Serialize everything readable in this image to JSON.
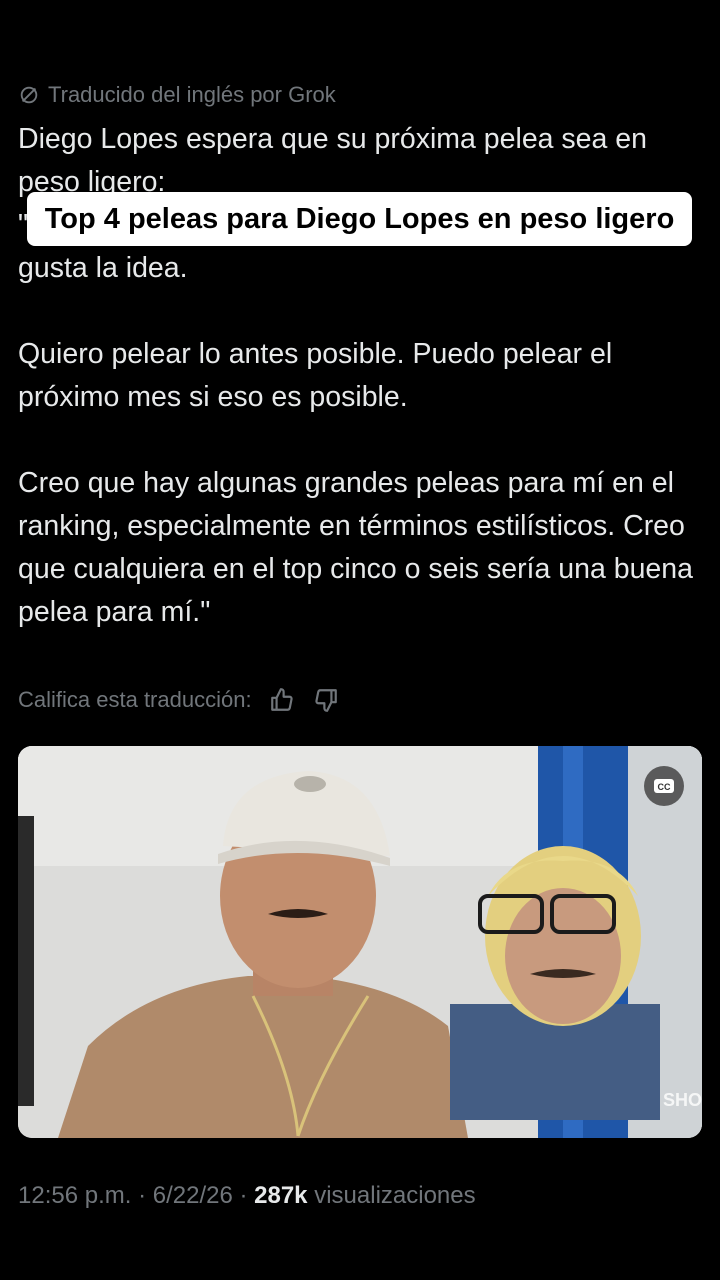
{
  "translation_note": "Traducido del inglés por Grok",
  "overlay_title": "Top 4 peleas para Diego Lopes en peso ligero",
  "tweet": {
    "line1": "Diego Lopes espera que su próxima pelea sea en",
    "line2": "peso ligero:",
    "quote1": "\"Estoy abierto a subir a 155. Hablé con la UFC, y les gusta la idea.",
    "quote2": "Quiero pelear lo antes posible. Puedo pelear el próximo mes si eso es posible.",
    "quote3": "Creo que hay algunas grandes peleas para mí en el ranking, especialmente en términos estilísticos. Creo que cualquiera en el top cinco o seis sería una buena pelea para mí.\""
  },
  "rate_label": "Califica esta traducción:",
  "cc_label": "CC",
  "meta": {
    "time": "12:56 p.m.",
    "date": "6/22/26",
    "views_count": "287k",
    "views_label": "visualizaciones"
  }
}
